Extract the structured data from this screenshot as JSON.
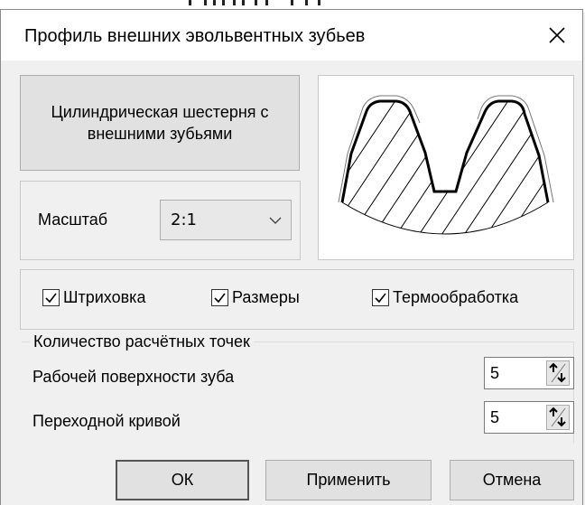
{
  "dialog": {
    "title": "Профиль внешних эвольвентных зубьев",
    "gear_type_label": "Цилиндрическая шестерня с внешними зубьями",
    "scale": {
      "label": "Масштаб",
      "value": "2:1"
    },
    "options": [
      {
        "label": "Штриховка",
        "checked": true
      },
      {
        "label": "Размеры",
        "checked": true
      },
      {
        "label": "Термообработка",
        "checked": true
      }
    ],
    "points": {
      "legend": "Количество расчётных точек",
      "rows": [
        {
          "label": "Рабочей поверхности зуба",
          "value": "5"
        },
        {
          "label": "Переходной кривой",
          "value": "5"
        }
      ]
    },
    "buttons": {
      "ok": "ОК",
      "apply": "Применить",
      "cancel": "Отмена"
    }
  },
  "icons": [
    "close-icon",
    "chevron-down-icon",
    "spin-arrows-icon",
    "checkmark-icon",
    "gear-tooth-profile-preview"
  ],
  "colors": {
    "titlebar": "#ffffff",
    "dialog_bg": "#f0f0f0",
    "button_face": "#e1e1e1",
    "border": "#adadad"
  }
}
